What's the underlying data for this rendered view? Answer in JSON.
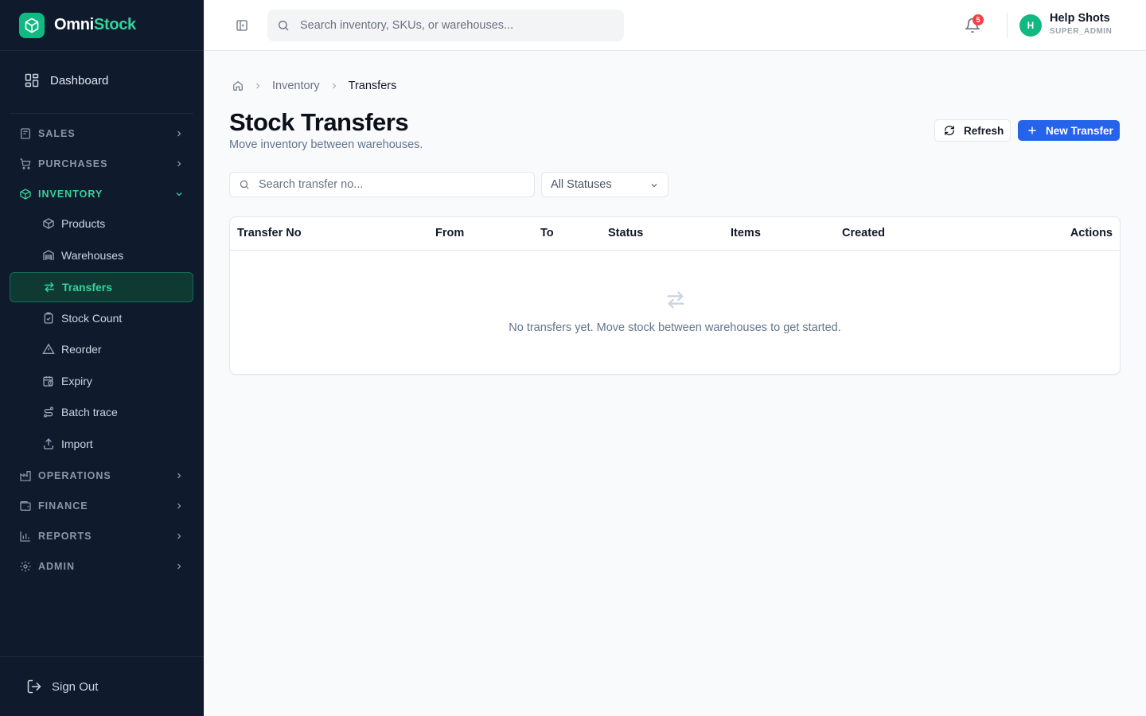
{
  "brand": {
    "name_part1": "Omni",
    "name_part2": "Stock",
    "accent_color": "#34d399"
  },
  "sidebar": {
    "dashboard_label": "Dashboard",
    "sections": [
      {
        "label": "SALES",
        "icon": "receipt-icon"
      },
      {
        "label": "PURCHASES",
        "icon": "cart-icon"
      },
      {
        "label": "INVENTORY",
        "icon": "package-icon",
        "expanded": true
      },
      {
        "label": "OPERATIONS",
        "icon": "factory-icon"
      },
      {
        "label": "FINANCE",
        "icon": "wallet-icon"
      },
      {
        "label": "REPORTS",
        "icon": "bar-chart-icon"
      },
      {
        "label": "ADMIN",
        "icon": "gear-icon"
      }
    ],
    "inventory_items": [
      {
        "label": "Products",
        "icon": "box-icon"
      },
      {
        "label": "Warehouses",
        "icon": "warehouse-icon"
      },
      {
        "label": "Transfers",
        "icon": "arrows-swap-icon",
        "active": true
      },
      {
        "label": "Stock Count",
        "icon": "clipboard-check-icon"
      },
      {
        "label": "Reorder",
        "icon": "warning-triangle-icon"
      },
      {
        "label": "Expiry",
        "icon": "calendar-clock-icon"
      },
      {
        "label": "Batch trace",
        "icon": "route-icon"
      },
      {
        "label": "Import",
        "icon": "upload-icon"
      }
    ],
    "signout_label": "Sign Out"
  },
  "header": {
    "search_placeholder": "Search inventory, SKUs, or warehouses...",
    "notification_count": "5",
    "user": {
      "initial": "H",
      "name": "Help Shots",
      "role": "SUPER_ADMIN"
    }
  },
  "breadcrumb": {
    "items": [
      "Inventory",
      "Transfers"
    ]
  },
  "page": {
    "title": "Stock Transfers",
    "subtitle": "Move inventory between warehouses.",
    "refresh_label": "Refresh",
    "new_label": "New Transfer",
    "primary_color": "#2563eb"
  },
  "filters": {
    "search_placeholder": "Search transfer no...",
    "status_value": "All Statuses"
  },
  "table": {
    "columns": [
      "Transfer No",
      "From",
      "To",
      "Status",
      "Items",
      "Created",
      "Actions"
    ],
    "rows": [],
    "empty_message": "No transfers yet. Move stock between warehouses to get started."
  }
}
